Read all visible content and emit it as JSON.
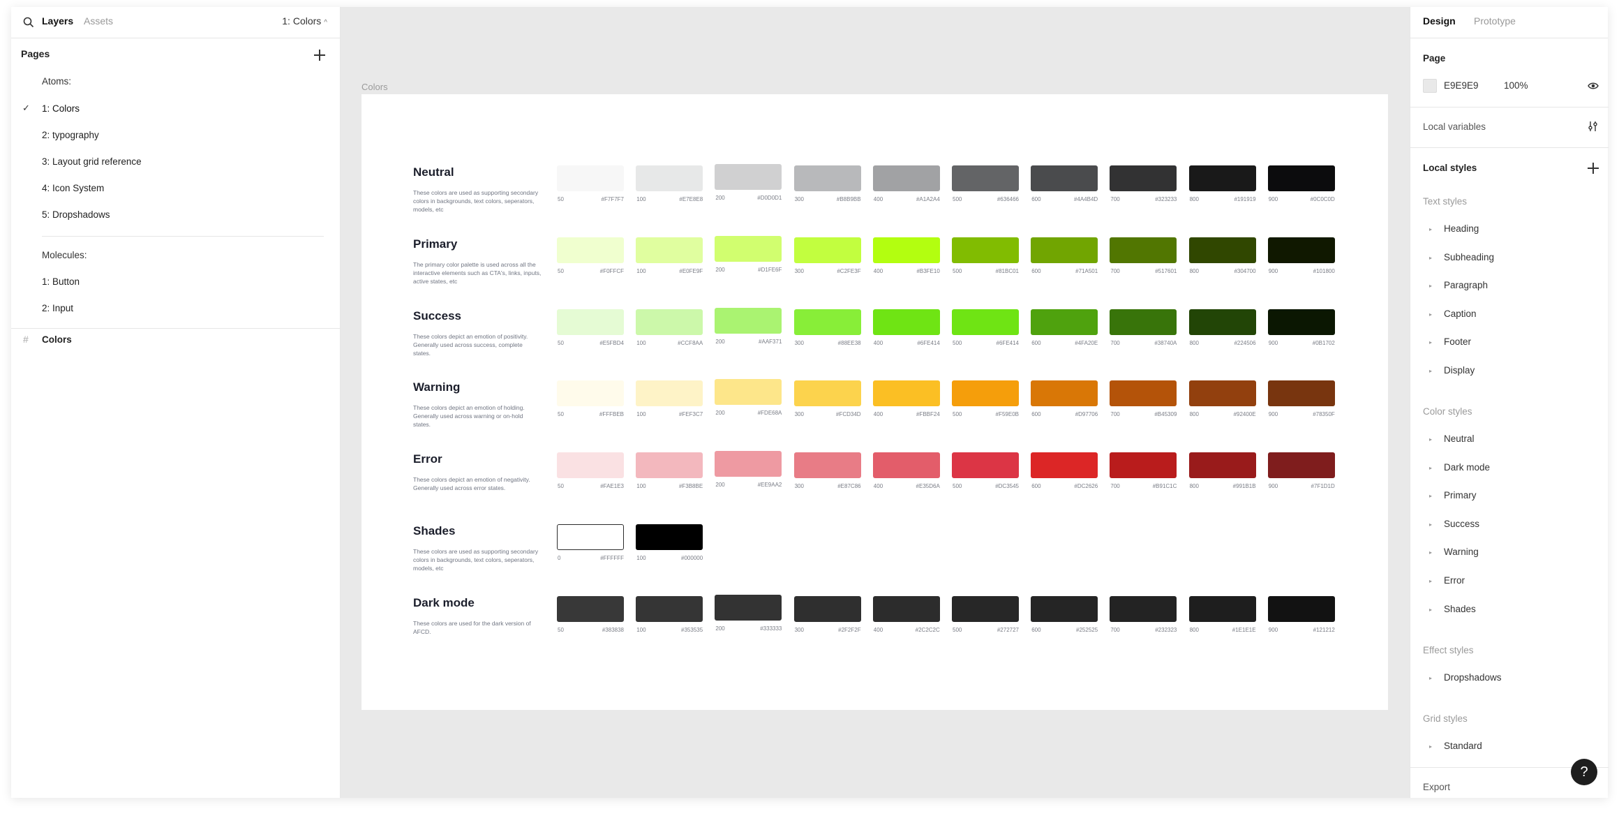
{
  "left_panel": {
    "tabs": {
      "layers": "Layers",
      "assets": "Assets"
    },
    "current_page": "1: Colors",
    "pages_header": "Pages",
    "pages": [
      "Atoms:",
      "1: Colors",
      "2: typography",
      "3: Layout grid reference",
      "4: Icon System",
      "5: Dropshadows",
      "Molecules:",
      "1: Button",
      "2: Input"
    ],
    "layer": "Colors"
  },
  "canvas": {
    "frame_label": "Colors",
    "groups": [
      {
        "title": "Neutral",
        "desc": "These colors are used as supporting secondary colors in backgrounds, text colors, seperators, models, etc",
        "swatches": [
          {
            "step": "50",
            "hex": "#F7F7F7"
          },
          {
            "step": "100",
            "hex": "#E7E8E8"
          },
          {
            "step": "200",
            "hex": "#D0D0D1"
          },
          {
            "step": "300",
            "hex": "#B8B9BB"
          },
          {
            "step": "400",
            "hex": "#A1A2A4"
          },
          {
            "step": "500",
            "hex": "#636466"
          },
          {
            "step": "600",
            "hex": "#4A4B4D"
          },
          {
            "step": "700",
            "hex": "#323233"
          },
          {
            "step": "800",
            "hex": "#191919"
          },
          {
            "step": "900",
            "hex": "#0C0C0D"
          }
        ]
      },
      {
        "title": "Primary",
        "desc": "The primary color palette is used across all the interactive elements such as CTA's, links, inputs, active states, etc",
        "swatches": [
          {
            "step": "50",
            "hex": "#F0FFCF"
          },
          {
            "step": "100",
            "hex": "#E0FE9F"
          },
          {
            "step": "200",
            "hex": "#D1FE6F"
          },
          {
            "step": "300",
            "hex": "#C2FE3F"
          },
          {
            "step": "400",
            "hex": "#B3FE10"
          },
          {
            "step": "500",
            "hex": "#81BC01"
          },
          {
            "step": "600",
            "hex": "#71A501"
          },
          {
            "step": "700",
            "hex": "#517601"
          },
          {
            "step": "800",
            "hex": "#304700"
          },
          {
            "step": "900",
            "hex": "#101800"
          }
        ]
      },
      {
        "title": "Success",
        "desc": "These colors depict an emotion of positivity. Generally used across success, complete states.",
        "swatches": [
          {
            "step": "50",
            "hex": "#E5FBD4"
          },
          {
            "step": "100",
            "hex": "#CCF8AA"
          },
          {
            "step": "200",
            "hex": "#AAF371"
          },
          {
            "step": "300",
            "hex": "#88EE38"
          },
          {
            "step": "400",
            "hex": "#6FE414"
          },
          {
            "step": "500",
            "hex": "#6FE414"
          },
          {
            "step": "600",
            "hex": "#4FA20E"
          },
          {
            "step": "700",
            "hex": "#38740A"
          },
          {
            "step": "800",
            "hex": "#224506"
          },
          {
            "step": "900",
            "hex": "#0B1702"
          }
        ]
      },
      {
        "title": "Warning",
        "desc": "These colors depict an emotion of holding. Generally used across warning or on-hold states.",
        "swatches": [
          {
            "step": "50",
            "hex": "#FFFBEB"
          },
          {
            "step": "100",
            "hex": "#FEF3C7"
          },
          {
            "step": "200",
            "hex": "#FDE68A"
          },
          {
            "step": "300",
            "hex": "#FCD34D"
          },
          {
            "step": "400",
            "hex": "#FBBF24"
          },
          {
            "step": "500",
            "hex": "#F59E0B"
          },
          {
            "step": "600",
            "hex": "#D97706"
          },
          {
            "step": "700",
            "hex": "#B45309"
          },
          {
            "step": "800",
            "hex": "#92400E"
          },
          {
            "step": "900",
            "hex": "#78350F"
          }
        ]
      },
      {
        "title": "Error",
        "desc": "These colors depict an emotion of negativity. Generally used across error states.",
        "swatches": [
          {
            "step": "50",
            "hex": "#FAE1E3"
          },
          {
            "step": "100",
            "hex": "#F3B8BE"
          },
          {
            "step": "200",
            "hex": "#EE9AA2"
          },
          {
            "step": "300",
            "hex": "#E87C86"
          },
          {
            "step": "400",
            "hex": "#E35D6A"
          },
          {
            "step": "500",
            "hex": "#DC3545"
          },
          {
            "step": "600",
            "hex": "#DC2626"
          },
          {
            "step": "700",
            "hex": "#B91C1C"
          },
          {
            "step": "800",
            "hex": "#991B1B"
          },
          {
            "step": "900",
            "hex": "#7F1D1D"
          }
        ]
      },
      {
        "title": "Shades",
        "desc": "These colors are used as supporting secondary colors in backgrounds, text colors, seperators, models, etc",
        "swatches": [
          {
            "step": "0",
            "hex": "#FFFFFF"
          },
          {
            "step": "100",
            "hex": "#000000"
          }
        ]
      },
      {
        "title": "Dark mode",
        "desc": "These colors are used for the dark version of AFCD.",
        "swatches": [
          {
            "step": "50",
            "hex": "#383838"
          },
          {
            "step": "100",
            "hex": "#353535"
          },
          {
            "step": "200",
            "hex": "#333333"
          },
          {
            "step": "300",
            "hex": "#2F2F2F"
          },
          {
            "step": "400",
            "hex": "#2C2C2C"
          },
          {
            "step": "500",
            "hex": "#272727"
          },
          {
            "step": "600",
            "hex": "#252525"
          },
          {
            "step": "700",
            "hex": "#232323"
          },
          {
            "step": "800",
            "hex": "#1E1E1E"
          },
          {
            "step": "900",
            "hex": "#121212"
          }
        ]
      }
    ]
  },
  "right_panel": {
    "tabs": {
      "design": "Design",
      "prototype": "Prototype"
    },
    "page_section": {
      "title": "Page",
      "color_hex": "E9E9E9",
      "opacity": "100%",
      "swatch_color": "#E9E9E9"
    },
    "local_variables": "Local variables",
    "local_styles": "Local styles",
    "text_styles": {
      "title": "Text styles",
      "items": [
        "Heading",
        "Subheading",
        "Paragraph",
        "Caption",
        "Footer",
        "Display"
      ]
    },
    "color_styles": {
      "title": "Color styles",
      "items": [
        "Neutral",
        "Dark mode",
        "Primary",
        "Success",
        "Warning",
        "Error",
        "Shades"
      ]
    },
    "effect_styles": {
      "title": "Effect styles",
      "items": [
        "Dropshadows"
      ]
    },
    "grid_styles": {
      "title": "Grid styles",
      "items": [
        "Standard"
      ]
    },
    "export": "Export",
    "help": "?"
  }
}
